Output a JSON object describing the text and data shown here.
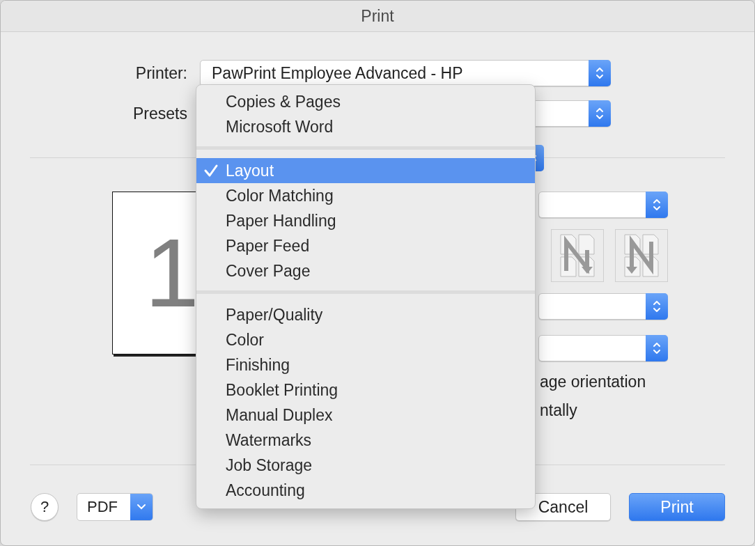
{
  "window": {
    "title": "Print"
  },
  "printer": {
    "label": "Printer:",
    "value": "PawPrint Employee Advanced - HP"
  },
  "presets": {
    "label": "Presets"
  },
  "preview": {
    "page_number": "1"
  },
  "layout_texts": [
    "age orientation",
    "ntally"
  ],
  "panel_menu": {
    "groups": [
      {
        "items": [
          {
            "label": "Copies & Pages",
            "selected": false
          },
          {
            "label": "Microsoft Word",
            "selected": false
          }
        ]
      },
      {
        "items": [
          {
            "label": "Layout",
            "selected": true
          },
          {
            "label": "Color Matching",
            "selected": false
          },
          {
            "label": "Paper Handling",
            "selected": false
          },
          {
            "label": "Paper Feed",
            "selected": false
          },
          {
            "label": "Cover Page",
            "selected": false
          }
        ]
      },
      {
        "items": [
          {
            "label": "Paper/Quality",
            "selected": false
          },
          {
            "label": "Color",
            "selected": false
          },
          {
            "label": "Finishing",
            "selected": false
          },
          {
            "label": "Booklet Printing",
            "selected": false
          },
          {
            "label": "Manual Duplex",
            "selected": false
          },
          {
            "label": "Watermarks",
            "selected": false
          },
          {
            "label": "Job Storage",
            "selected": false
          },
          {
            "label": "Accounting",
            "selected": false
          }
        ]
      }
    ]
  },
  "buttons": {
    "help": "?",
    "pdf": "PDF",
    "cancel": "Cancel",
    "print": "Print"
  }
}
